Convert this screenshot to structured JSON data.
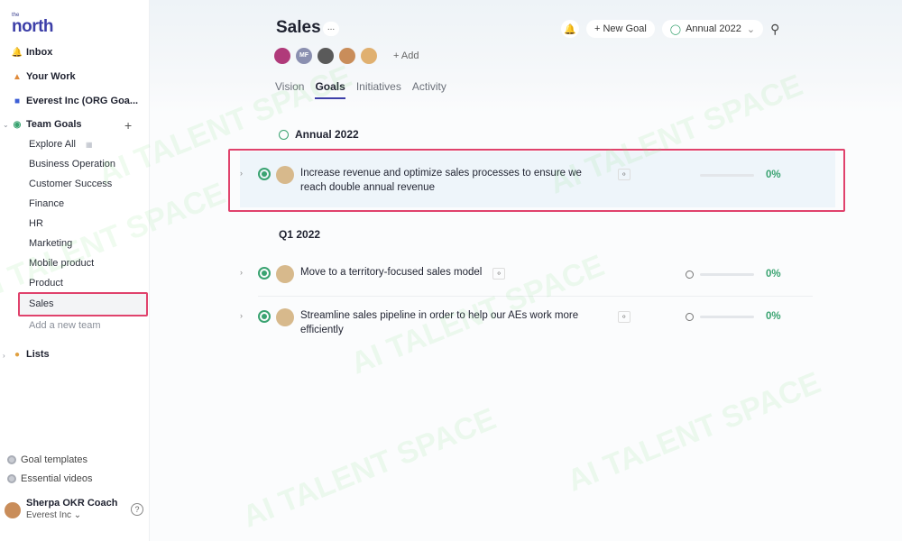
{
  "brand": {
    "small": "the",
    "name": "north"
  },
  "sidebar": {
    "inbox": "Inbox",
    "your_work": "Your Work",
    "org": "Everest Inc (ORG Goa...",
    "team_goals": "Team Goals",
    "teams": [
      "Explore All",
      "Business Operation",
      "Customer Success",
      "Finance",
      "HR",
      "Marketing",
      "Mobile product",
      "Product",
      "Sales"
    ],
    "add_team": "Add a new team",
    "lists": "Lists",
    "goal_templates": "Goal templates",
    "essential_videos": "Essential videos",
    "user": {
      "name": "Sherpa OKR Coach",
      "org": "Everest Inc"
    }
  },
  "header": {
    "title": "Sales",
    "more": "...",
    "avatars": [
      {
        "initials": "",
        "color": "#b03a7a"
      },
      {
        "initials": "MF",
        "color": "#8a8fb0"
      },
      {
        "initials": "",
        "color": "#5a5a5a"
      },
      {
        "initials": "",
        "color": "#c98d5a"
      },
      {
        "initials": "",
        "color": "#e0b070"
      }
    ],
    "add_member": "+ Add",
    "tabs": [
      "Vision",
      "Goals",
      "Initiatives",
      "Activity"
    ],
    "active_tab": "Goals",
    "new_goal": "+ New Goal",
    "period": "Annual 2022"
  },
  "sections": [
    {
      "label": "Annual 2022",
      "goals": [
        {
          "title": "Increase revenue and optimize sales processes to ensure we reach double annual revenue",
          "progress": 0,
          "pct": "0%"
        }
      ]
    },
    {
      "label": "Q1 2022",
      "goals": [
        {
          "title": "Move to a territory-focused sales model",
          "progress": 0,
          "pct": "0%"
        },
        {
          "title": "Streamline sales pipeline in order to help our AEs work more efficiently",
          "progress": 0,
          "pct": "0%"
        }
      ]
    }
  ],
  "watermark": "AI TALENT SPACE",
  "colors": {
    "accent": "#3d3fa8",
    "success": "#3aa371",
    "highlight": "#e0426c"
  }
}
